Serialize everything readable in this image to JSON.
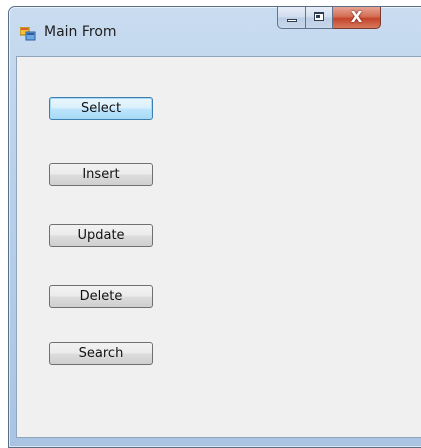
{
  "window": {
    "title": "Main From",
    "app_icon": "form-app-icon",
    "caption": {
      "minimize_icon": "minimize-icon",
      "maximize_icon": "maximize-icon",
      "close_icon": "close-icon",
      "close_glyph": "X"
    }
  },
  "buttons": {
    "select_label": "Select",
    "insert_label": "Insert",
    "update_label": "Update",
    "delete_label": "Delete",
    "search_label": "Search"
  },
  "colors": {
    "close_red": "#c4442b",
    "focus_blue": "#3c7fb1",
    "form_background": "#f0f0f0"
  }
}
